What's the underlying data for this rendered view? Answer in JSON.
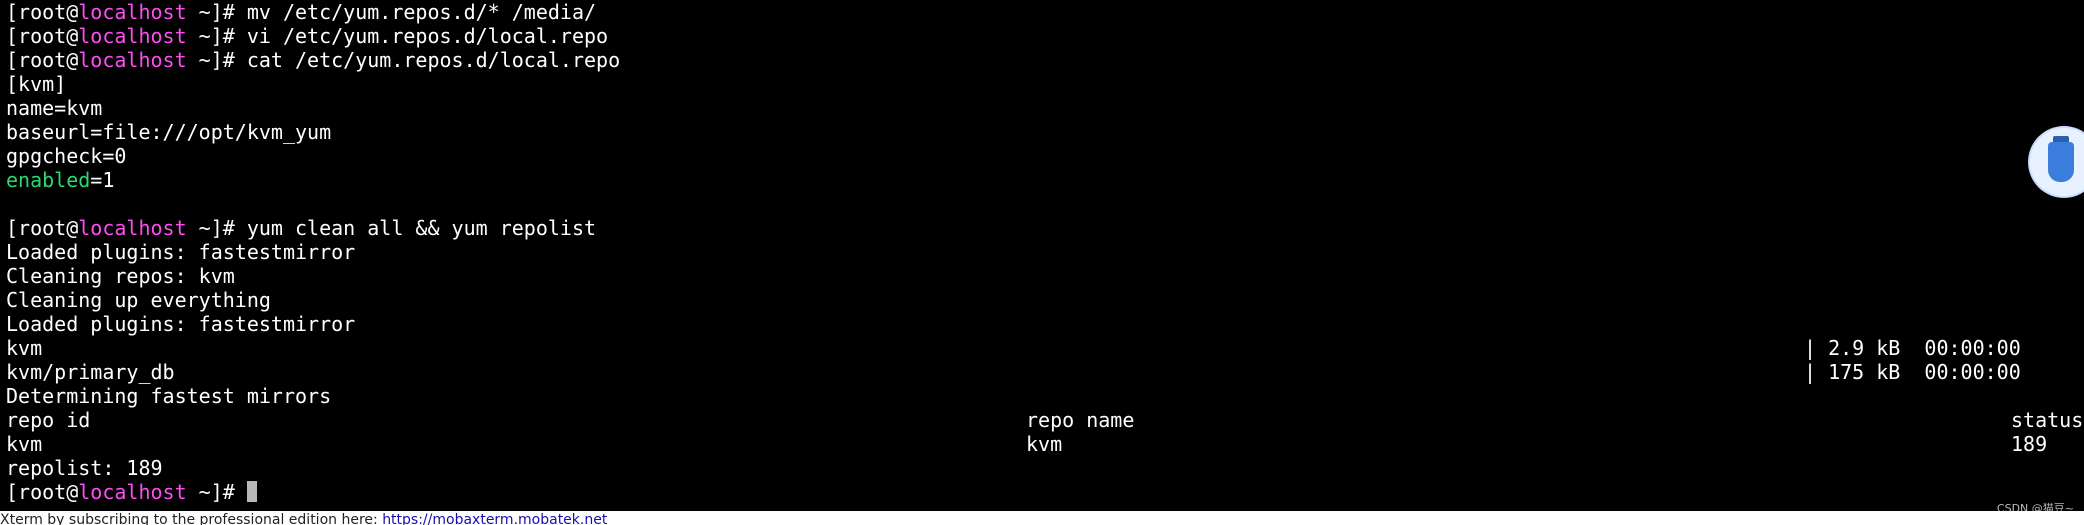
{
  "prompt": {
    "open": "[root@",
    "host": "localhost",
    "close": " ~]# "
  },
  "session": [
    {
      "type": "cmd",
      "text": "mv /etc/yum.repos.d/* /media/"
    },
    {
      "type": "cmd",
      "text": "vi /etc/yum.repos.d/local.repo"
    },
    {
      "type": "cmd",
      "text": "cat /etc/yum.repos.d/local.repo"
    },
    {
      "type": "out",
      "text": "[kvm]"
    },
    {
      "type": "out",
      "text": "name=kvm"
    },
    {
      "type": "out",
      "text": "baseurl=file:///opt/kvm_yum"
    },
    {
      "type": "out",
      "text": "gpgcheck=0"
    },
    {
      "type": "kv",
      "key": "enabled",
      "value": "=1"
    },
    {
      "type": "out",
      "text": ""
    },
    {
      "type": "cmd",
      "text": "yum clean all && yum repolist"
    },
    {
      "type": "out",
      "text": "Loaded plugins: fastestmirror"
    },
    {
      "type": "out",
      "text": "Cleaning repos: kvm"
    },
    {
      "type": "out",
      "text": "Cleaning up everything"
    },
    {
      "type": "out",
      "text": "Loaded plugins: fastestmirror"
    },
    {
      "type": "out",
      "text": "kvm"
    },
    {
      "type": "out",
      "text": "kvm/primary_db"
    },
    {
      "type": "out",
      "text": "Determining fastest mirrors"
    },
    {
      "type": "out",
      "text": "repo id"
    },
    {
      "type": "out",
      "text": "kvm"
    },
    {
      "type": "out",
      "text": "repolist: 189"
    },
    {
      "type": "cursor",
      "text": ""
    }
  ],
  "right_columns": {
    "download_1": "| 2.9 kB  00:00:00",
    "download_2": "| 175 kB  00:00:00",
    "repo_name_header": "repo name",
    "repo_name_value": "kvm",
    "status_header": "status",
    "status_value": "189"
  },
  "widget": {
    "icon": "usb-drive-icon"
  },
  "watermark": "CSDN @猫豆~",
  "footer": {
    "text": "Xterm by subscribing to the professional edition here:",
    "link": "https://mobaxterm.mobatek.net"
  },
  "colors": {
    "background": "#000000",
    "foreground": "#ffffff",
    "host": "#ff4df0",
    "enabled_key": "#2bd96a",
    "cursor": "#b8b8b8"
  }
}
